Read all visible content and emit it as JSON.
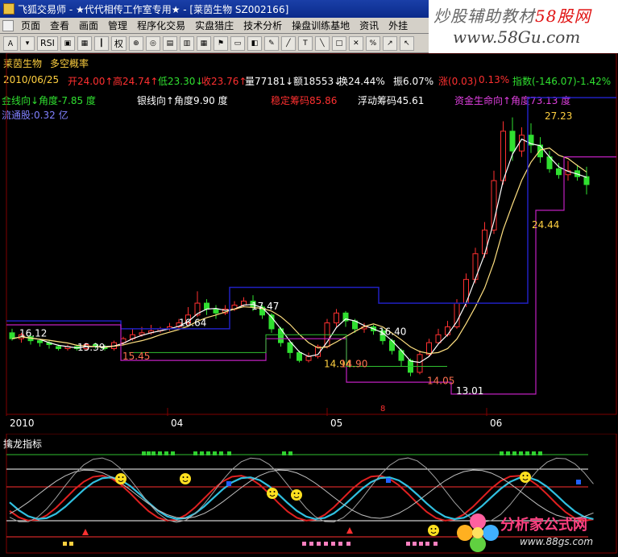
{
  "window": {
    "title": "飞狐交易师 - ★代代相传工作室专用★ - [莱茵生物 SZ002166]"
  },
  "watermark_top": {
    "line1_a": "炒股辅助教材",
    "line1_b": "58股网",
    "line2": "www.58Gu.com"
  },
  "menu": [
    "页面",
    "查看",
    "画面",
    "管理",
    "程序化交易",
    "实盘猎庄",
    "技术分析",
    "操盘训练基地",
    "资讯",
    "外挂"
  ],
  "toolbar": {
    "rsi_label": "RSI",
    "quan_label": "权"
  },
  "header": {
    "stock_name": "莱茵生物",
    "chart_mode": "多空概率",
    "date": "2010/06/25",
    "open": "开24.00↑",
    "high": "高24.74↑",
    "low": "低23.30↓",
    "close": "收23.76↑",
    "volume": "量77181↓",
    "amount": "额18553↓",
    "turnover": "换24.44%",
    "amplitude": "振6.07%",
    "change": "涨(0.03)",
    "change_pct": "0.13%",
    "index": "指数(-146.07)-1.42%"
  },
  "indicators": {
    "gold_line": "金线向↓角度-7.85 度",
    "silver_line": "银线向↑角度9.90 度",
    "stable_chips": "稳定筹码85.86",
    "floating_chips": "浮动筹码45.61",
    "capital_life": "资金生命向↑角度73.13 度",
    "float_shares": "流通股:0.32 亿"
  },
  "price_labels": [
    "16.12",
    "15.39",
    "15.45",
    "16.64",
    "17.47",
    "14.94",
    "14.90",
    "16.40",
    "14.05",
    "13.01",
    "24.44",
    "27.23"
  ],
  "axis_labels": [
    "2010",
    "04",
    "05",
    "06"
  ],
  "axis_marker": "8",
  "sub_chart": {
    "name": "擒龙指标"
  },
  "watermark_bottom": {
    "brand": "分析家公式网",
    "url": "www.88gs.com"
  },
  "colors": {
    "up": "#ff3030",
    "down": "#30e030",
    "gold_line": "#ffffff",
    "channel_blue": "#2020c0",
    "channel_purple": "#c020c0"
  }
}
